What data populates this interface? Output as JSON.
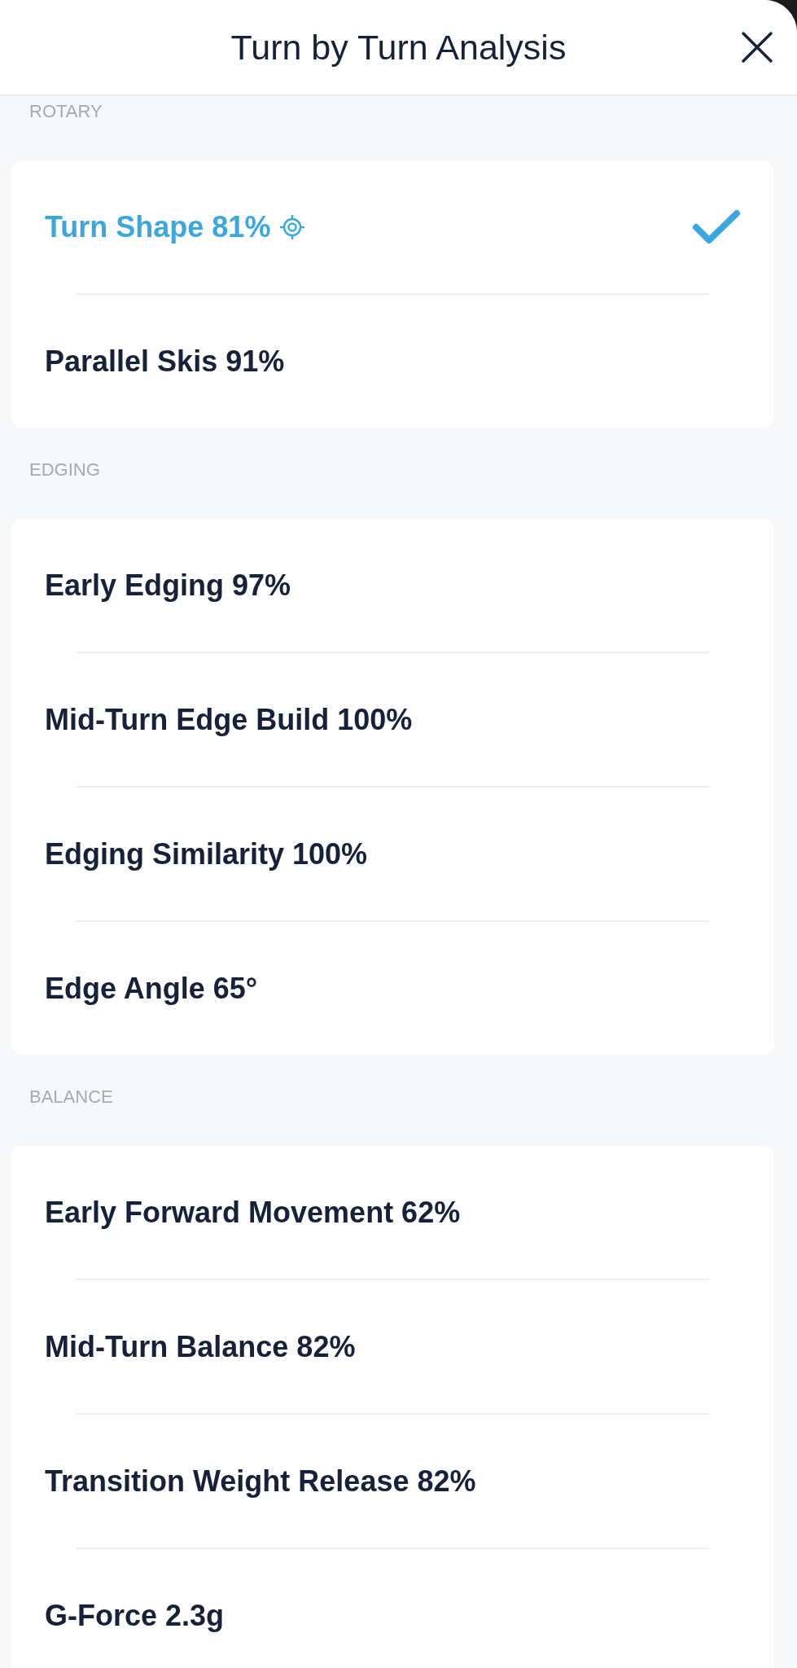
{
  "header": {
    "title": "Turn by Turn Analysis"
  },
  "sections": [
    {
      "label": "ROTARY",
      "items": [
        {
          "label": "Turn Shape 81%",
          "selected": true,
          "targeted": true
        },
        {
          "label": "Parallel Skis 91%",
          "selected": false,
          "targeted": false
        }
      ]
    },
    {
      "label": "EDGING",
      "items": [
        {
          "label": "Early Edging 97%",
          "selected": false,
          "targeted": false
        },
        {
          "label": "Mid-Turn Edge Build 100%",
          "selected": false,
          "targeted": false
        },
        {
          "label": "Edging Similarity 100%",
          "selected": false,
          "targeted": false
        },
        {
          "label": "Edge Angle 65°",
          "selected": false,
          "targeted": false
        }
      ]
    },
    {
      "label": "BALANCE",
      "items": [
        {
          "label": "Early Forward Movement 62%",
          "selected": false,
          "targeted": false
        },
        {
          "label": "Mid-Turn Balance 82%",
          "selected": false,
          "targeted": false
        },
        {
          "label": "Transition Weight Release 82%",
          "selected": false,
          "targeted": false
        },
        {
          "label": "G-Force 2.3g",
          "selected": false,
          "targeted": false
        }
      ]
    }
  ]
}
